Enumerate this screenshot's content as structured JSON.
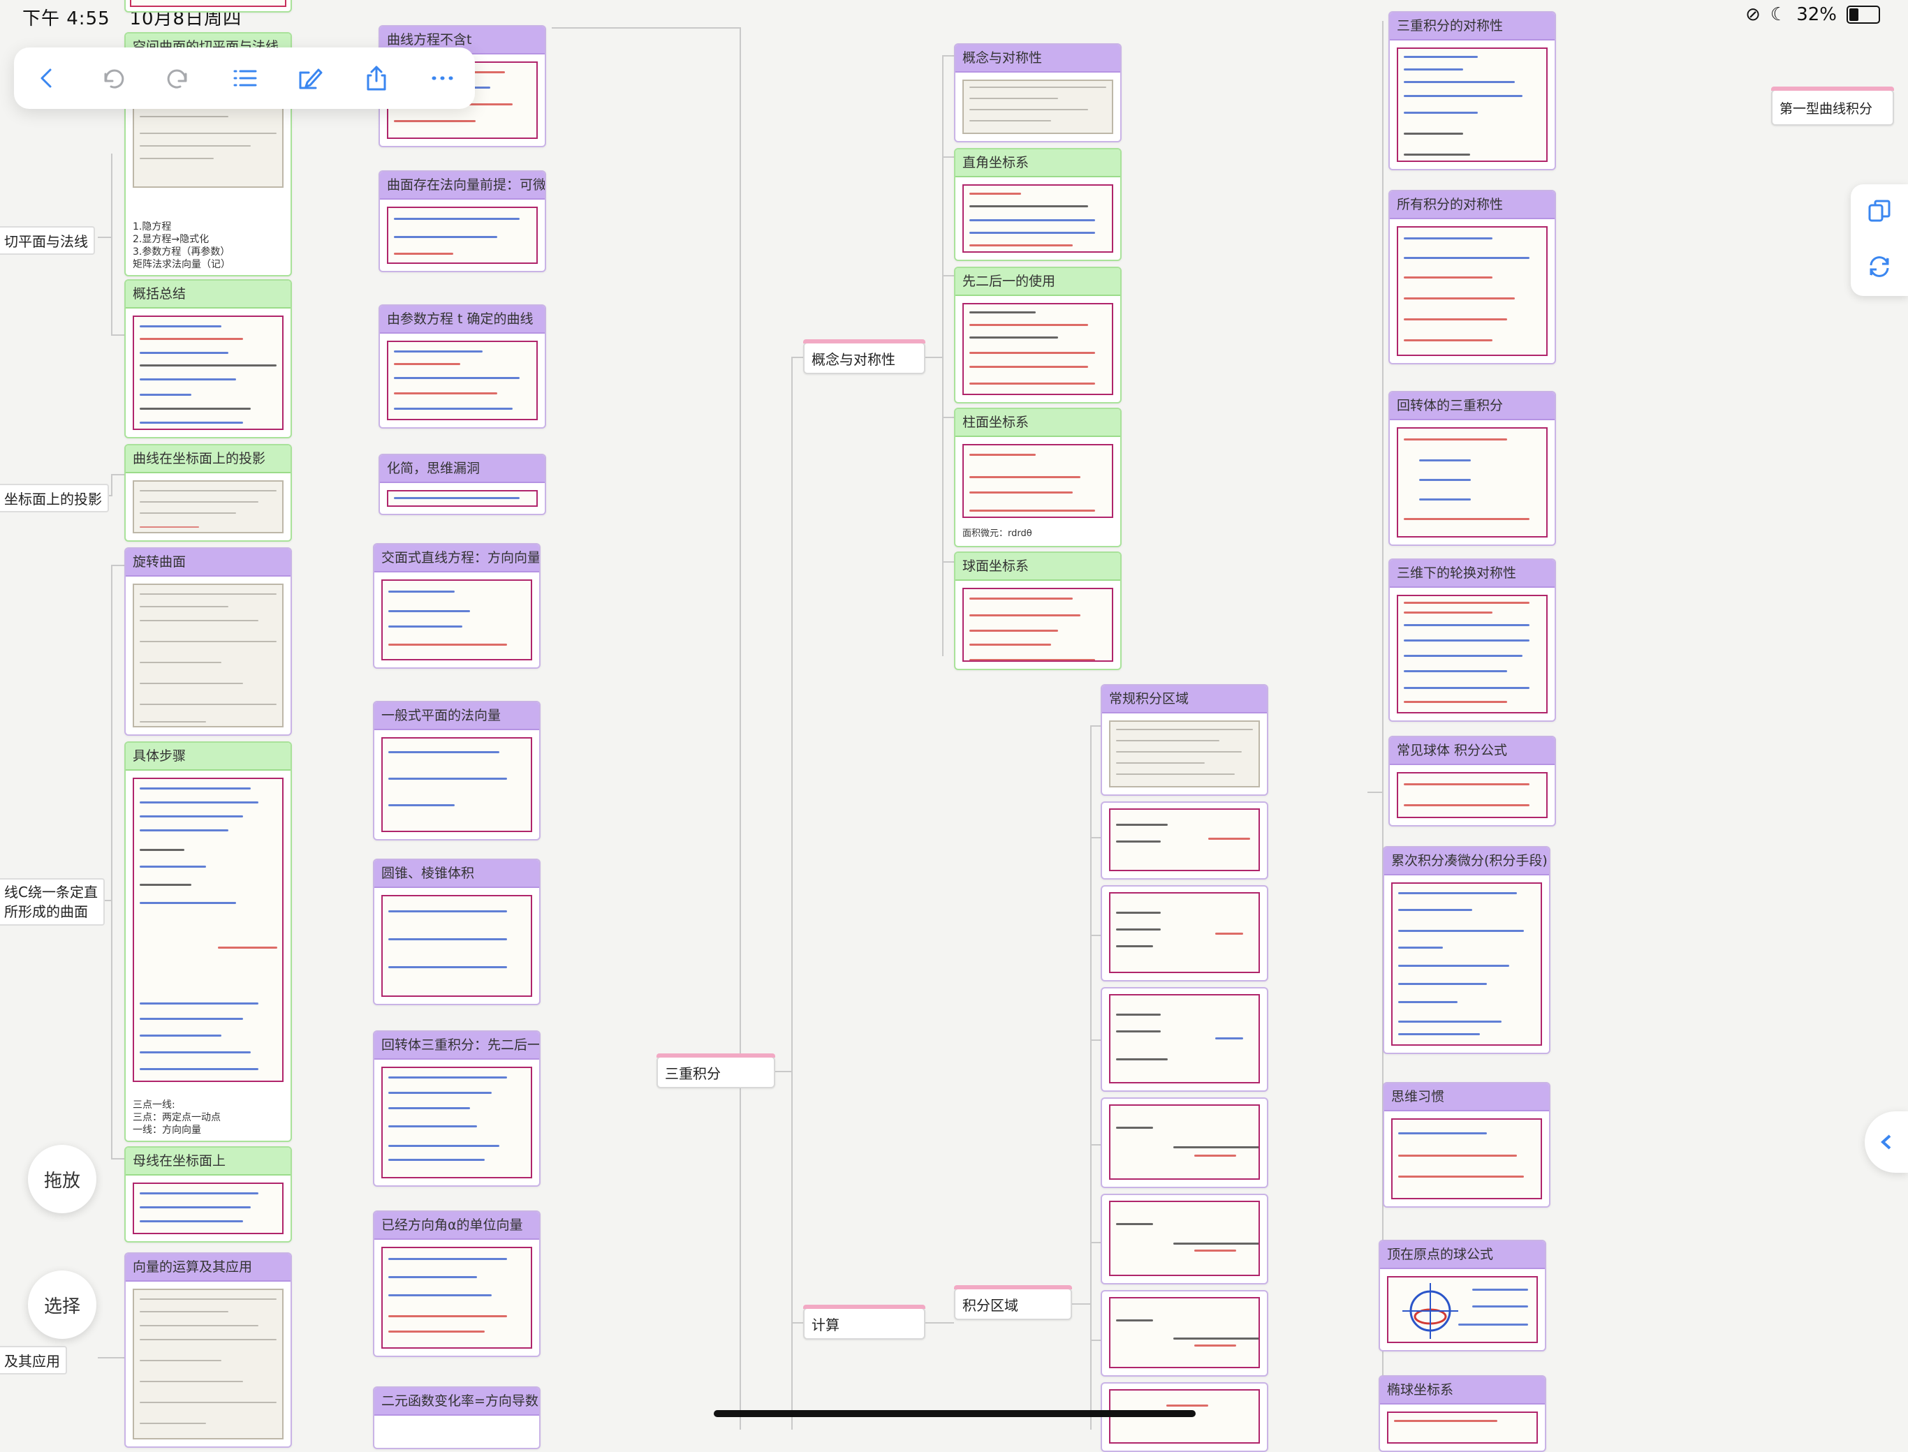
{
  "status": {
    "time": "下午 4:55",
    "date": "10月8日周四",
    "battery": "32%"
  },
  "toolbar": {
    "back": "chevron-left-icon",
    "undo": "undo-icon",
    "redo": "redo-icon",
    "outline": "list-icon",
    "edit": "edit-icon",
    "share": "share-icon",
    "more": "more-icon"
  },
  "left_labels": {
    "tangent": "切平面与法线",
    "projection": "坐标面上的投影",
    "surface": "线C绕一条定直\n所形成的曲面",
    "application": "及其应用"
  },
  "col1": {
    "top_card": "空间曲面的切平面与法线",
    "top_text": "1.隐方程\n2.显方程→隐式化\n3.参数方程（再参数）\n矩阵法求法向量（记）",
    "summary": "概括总结",
    "projection": "曲线在坐标面上的投影",
    "rotation": "旋转曲面",
    "steps": "具体步骤",
    "steps_text": "三点一线:\n三点：两定点一动点\n一线：方向向量",
    "generatrix": "母线在坐标面上",
    "vector_ops": "向量的运算及其应用"
  },
  "col2": {
    "c1": "曲线方程不含t",
    "c2": "曲面存在法向量前提：可微",
    "c3": "由参数方程 t 确定的曲线",
    "c4": "化简，思维漏洞",
    "c5": "交面式直线方程：方向向量",
    "c6": "一般式平面的法向量",
    "c7": "圆锥、棱锥体积",
    "c8": "回转体三重积分：先二后一",
    "c9": "已经方向角α的单位向量",
    "c10": "二元函数变化率=方向导数"
  },
  "topics": {
    "root": "三重积分",
    "concept": "概念与对称性",
    "calc": "计算",
    "region": "积分区域"
  },
  "col3": {
    "c1": "概念与对称性",
    "c2": "直角坐标系",
    "c3": "先二后一的使用",
    "c4": "柱面坐标系",
    "c4_text": "面积微元：rdrdθ",
    "c5": "球面坐标系"
  },
  "col4": {
    "region_title": "常规积分区域"
  },
  "col5": {
    "c1": "三重积分的对称性",
    "c2": "所有积分的对称性",
    "c3": "回转体的三重积分",
    "c4": "三维下的轮换对称性",
    "c5": "常见球体  积分公式",
    "c6": "累次积分凑微分(积分手段)",
    "c7": "思维习惯",
    "c8": "顶在原点的球公式",
    "c9": "椭球坐标系"
  },
  "right_node": "第一型曲线积分",
  "buttons": {
    "drag": "拖放",
    "select": "选择"
  },
  "colors": {
    "accent": "#3a86f0",
    "purple_header": "#c9aef0",
    "green_header": "#c8f2bf",
    "ink_red": "#d23b35",
    "ink_blue": "#2b55c9"
  }
}
